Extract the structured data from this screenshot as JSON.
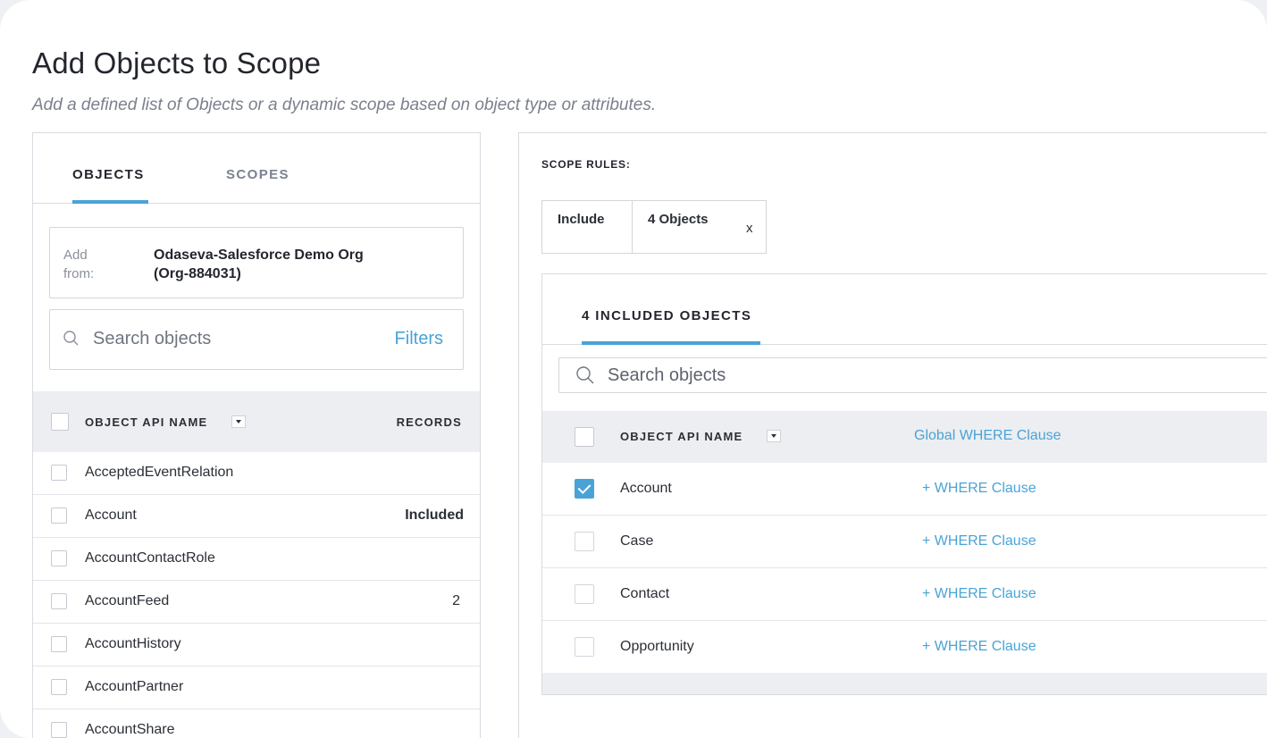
{
  "page": {
    "title": "Add Objects to Scope",
    "subtitle": "Add a defined list of Objects or a dynamic scope based on object type or attributes."
  },
  "left": {
    "tabs": [
      {
        "label": "OBJECTS",
        "active": true
      },
      {
        "label": "SCOPES",
        "active": false
      }
    ],
    "add_from": {
      "label": "Add from:",
      "org_name": "Odaseva-Salesforce Demo Org",
      "org_id": "(Org-884031)"
    },
    "search": {
      "placeholder": "Search objects",
      "filters_label": "Filters"
    },
    "table": {
      "col_name": "OBJECT API NAME",
      "col_records": "RECORDS",
      "rows": [
        {
          "name": "AcceptedEventRelation",
          "records": ""
        },
        {
          "name": "Account",
          "records": "Included"
        },
        {
          "name": "AccountContactRole",
          "records": ""
        },
        {
          "name": "AccountFeed",
          "records": "2"
        },
        {
          "name": "AccountHistory",
          "records": ""
        },
        {
          "name": "AccountPartner",
          "records": ""
        },
        {
          "name": "AccountShare",
          "records": ""
        }
      ]
    }
  },
  "right": {
    "scope_rules_label": "SCOPE RULES:",
    "rule": {
      "mode": "Include",
      "value": "4 Objects",
      "remove": "x"
    },
    "included": {
      "tab_label": "4 INCLUDED OBJECTS",
      "search_placeholder": "Search objects",
      "col_name": "OBJECT API NAME",
      "col_where": "Global WHERE Clause",
      "rows": [
        {
          "name": "Account",
          "checked": true,
          "where": "+ WHERE Clause"
        },
        {
          "name": "Case",
          "checked": false,
          "where": "+ WHERE Clause"
        },
        {
          "name": "Contact",
          "checked": false,
          "where": "+ WHERE Clause"
        },
        {
          "name": "Opportunity",
          "checked": false,
          "where": "+ WHERE Clause"
        }
      ]
    }
  },
  "colors": {
    "accent": "#4aa3d6",
    "header_bg": "#eceef1",
    "text": "#2b2f36"
  }
}
